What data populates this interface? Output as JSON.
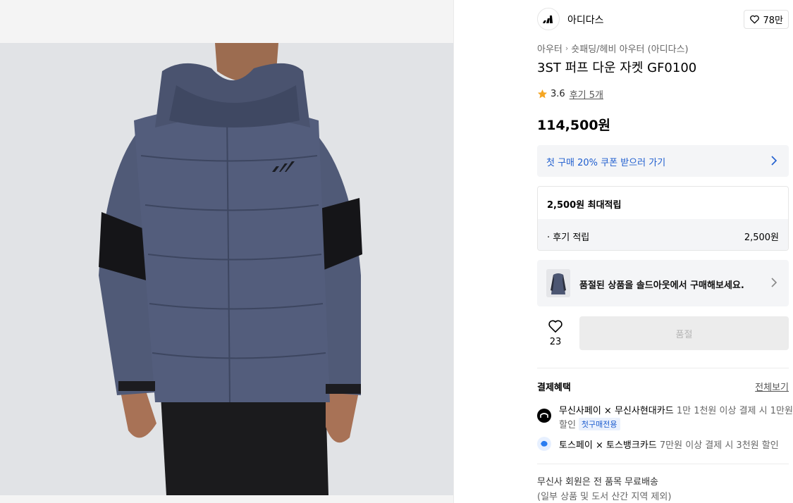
{
  "brand": {
    "name": "아디다스",
    "like_count": "78만",
    "logo_icon": "adidas-logo"
  },
  "breadcrumb": {
    "items": [
      "아우터",
      "숏패딩/헤비 아우터 (아디다스)"
    ]
  },
  "product": {
    "title": "3ST 퍼프 다운 자켓 GF0100",
    "rating": "3.6",
    "review_link": "후기 5개",
    "price": "114,500원"
  },
  "coupon": {
    "text": "첫 구매 20% 쿠폰 받으러 가기"
  },
  "points": {
    "header": "2,500원 최대적립",
    "row_label": "· 후기 적립",
    "row_value": "2,500원"
  },
  "soldout": {
    "text": "품절된 상품을 솔드아웃에서 구매해보세요."
  },
  "purchase": {
    "wish_count": "23",
    "button_label": "품절"
  },
  "benefits": {
    "title": "결제혜택",
    "view_all": "전체보기",
    "musinsa_name": "무신사페이 × 무신사현대카드",
    "musinsa_desc": "1만 1천원 이상 결제 시 1만원",
    "musinsa_desc2": "할인",
    "musinsa_tag": "첫구매전용",
    "toss_name": "토스페이 × 토스뱅크카드",
    "toss_desc": "7만원 이상 결제 시 3천원 할인"
  },
  "shipping": {
    "line1": "무신사 회원은 전 품목 무료배송",
    "line2": "(일부 상품 및 도서 산간 지역 제외)"
  },
  "colors": {
    "accent_blue": "#1f5ecf",
    "star": "#f5a623",
    "panel_bg": "#f4f5f7"
  }
}
